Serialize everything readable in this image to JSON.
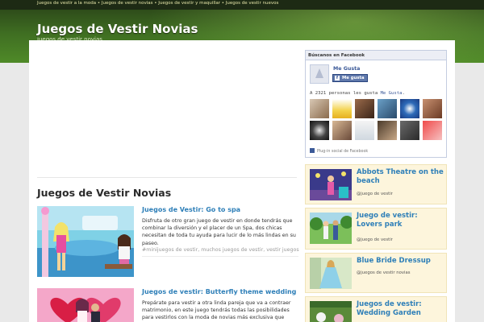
{
  "topbar": {
    "links": [
      "Juegos de vestir a la moda",
      "Juegos de vestir novias",
      "Juegos de vestir y maquillar",
      "Juegos de vestir nuevos"
    ],
    "separator": " • "
  },
  "header": {
    "title": "Juegos de Vestir Novias",
    "subtitle": "juegos de vestir novias"
  },
  "main": {
    "section_title": "Juegos de Vestir Novias",
    "posts": [
      {
        "title": "Juegos de Vestir: Go to spa",
        "excerpt": "Disfruta de otro gran juego de vestir en donde tendrás que combinar la diversión y el placer de un Spa, dos chicas necesitan de toda tu ayuda para lucir de lo más lindas en su paseo.",
        "tags": "#minijuegos de vestir, muchos juegos de vestir, vestir juegos"
      },
      {
        "title": "Juegos de vestir: Butterfly theme wedding",
        "excerpt": "Prepárate para vestir a otra linda pareja que va a contraer matrimonio, en este juego tendrás todas las posibilidades para vestirlos con la moda de novias más exclusiva que puedas",
        "tags": ""
      }
    ]
  },
  "facebook": {
    "header": "Búscanos en Facebook",
    "page_name": "Me Gusta",
    "like_label": "Me gusta",
    "count_prefix": "A 2321 personas les gusta ",
    "count_link": "Me Gusta",
    "count_suffix": ".",
    "footer": "Plug-in social de Facebook",
    "brand_color": "#3b5998"
  },
  "sidebar": {
    "items": [
      {
        "title": "Abbots Theatre on the beach",
        "author": "@juego de vestir"
      },
      {
        "title": "Juego de vestir: Lovers park",
        "author": "@juego de vestir"
      },
      {
        "title": "Blue Bride Dressup",
        "author": "@juegos de vestir novias"
      },
      {
        "title": "Juegos de vestir: Wedding Garden",
        "author": ""
      }
    ]
  },
  "colors": {
    "header_green": "#4f8a28",
    "link_blue": "#2e7fb8",
    "sidebar_bg": "#fdf5dc"
  }
}
